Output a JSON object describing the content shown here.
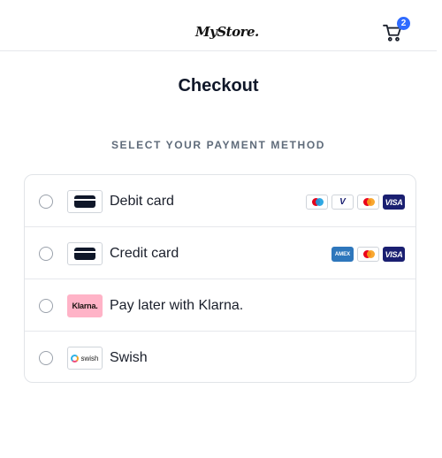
{
  "header": {
    "logo_text": "MyStore.",
    "cart": {
      "icon": "cart-icon",
      "count": "2"
    }
  },
  "checkout": {
    "title": "Checkout",
    "subtitle": "SELECT YOUR PAYMENT METHOD"
  },
  "payment_methods": [
    {
      "label": "Debit card",
      "icon": "card-icon",
      "brands": [
        "maestro",
        "v-pay",
        "mastercard",
        "visa"
      ]
    },
    {
      "label": "Credit card",
      "icon": "card-icon",
      "brands": [
        "amex",
        "mastercard",
        "visa"
      ]
    },
    {
      "label": "Pay later with Klarna.",
      "icon": "klarna-logo",
      "icon_text": "Klarna."
    },
    {
      "label": "Swish",
      "icon": "swish-logo",
      "icon_text": "swish"
    }
  ],
  "brand_logos": {
    "v_pay": "V",
    "visa": "VISA",
    "amex": "AMEX"
  },
  "colors": {
    "accent": "#2f6bff",
    "klarna_pink": "#ffb3c7",
    "visa_blue": "#1a1f71"
  }
}
